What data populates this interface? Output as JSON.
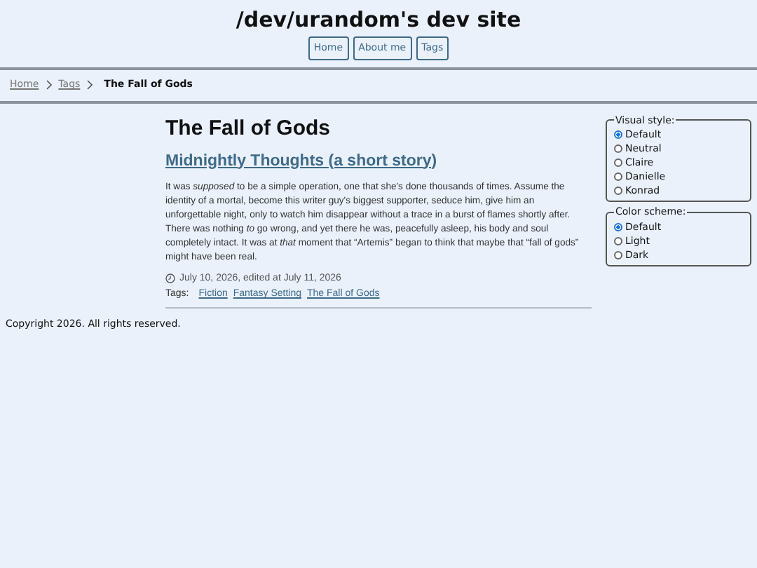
{
  "site_title": "/dev/urandom's dev site",
  "nav": [
    "Home",
    "About me",
    "Tags"
  ],
  "breadcrumb": {
    "links": [
      "Home",
      "Tags"
    ],
    "current": "The Fall of Gods"
  },
  "page_title": "The Fall of Gods",
  "post": {
    "title": "Midnightly Thoughts (a short story)",
    "body": "It was *supposed* to be a simple operation, one that she's done thousands of times. Assume the identity of a mortal, become this writer guy's biggest supporter, seduce him, give him an unforgettable night, only to watch him disappear without a trace in a burst of flames shortly after. There was nothing *to* go wrong, and yet there he was, peacefully asleep, his body and soul completely intact. It was at *that* moment that “Artemis” began to think that maybe that “fall of gods” might have been real.",
    "date": "July 10, 2026, edited at July 11, 2026",
    "tags_label": "Tags:",
    "tags": [
      "Fiction",
      "Fantasy Setting",
      "The Fall of Gods"
    ]
  },
  "settings": [
    {
      "legend": "Visual style:",
      "options": [
        {
          "label": "Default",
          "selected": true
        },
        {
          "label": "Neutral",
          "selected": false
        },
        {
          "label": "Claire",
          "selected": false
        },
        {
          "label": "Danielle",
          "selected": false
        },
        {
          "label": "Konrad",
          "selected": false
        }
      ]
    },
    {
      "legend": "Color scheme:",
      "options": [
        {
          "label": "Default",
          "selected": true
        },
        {
          "label": "Light",
          "selected": false
        },
        {
          "label": "Dark",
          "selected": false
        }
      ]
    }
  ],
  "footer": "Copyright 2026. All rights reserved."
}
